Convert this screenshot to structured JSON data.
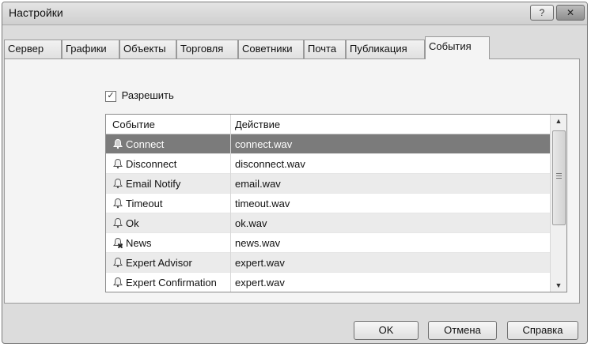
{
  "window": {
    "title": "Настройки",
    "help_label": "?",
    "close_label": "✕"
  },
  "tabs": [
    {
      "label": "Сервер"
    },
    {
      "label": "Графики"
    },
    {
      "label": "Объекты"
    },
    {
      "label": "Торговля"
    },
    {
      "label": "Советники"
    },
    {
      "label": "Почта"
    },
    {
      "label": "Публикация"
    },
    {
      "label": "События",
      "active": true
    }
  ],
  "events": {
    "enable_label": "Разрешить",
    "enable_checked": true,
    "columns": {
      "event": "Событие",
      "action": "Действие"
    },
    "rows": [
      {
        "event": "Connect",
        "action": "connect.wav",
        "icon": "bell-icon",
        "selected": true
      },
      {
        "event": "Disconnect",
        "action": "disconnect.wav",
        "icon": "bell-icon"
      },
      {
        "event": "Email Notify",
        "action": "email.wav",
        "icon": "bell-icon"
      },
      {
        "event": "Timeout",
        "action": "timeout.wav",
        "icon": "bell-icon"
      },
      {
        "event": "Ok",
        "action": "ok.wav",
        "icon": "bell-icon"
      },
      {
        "event": "News",
        "action": "news.wav",
        "icon": "bell-disabled-icon"
      },
      {
        "event": "Expert Advisor",
        "action": "expert.wav",
        "icon": "bell-icon"
      },
      {
        "event": "Expert Confirmation",
        "action": "expert.wav",
        "icon": "bell-icon"
      }
    ]
  },
  "buttons": {
    "ok": "OK",
    "cancel": "Отмена",
    "help": "Справка"
  }
}
